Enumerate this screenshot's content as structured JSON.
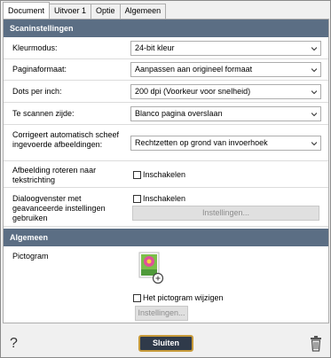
{
  "tabs": [
    "Document",
    "Uitvoer 1",
    "Optie",
    "Algemeen"
  ],
  "sections": {
    "scan": "Scaninstellingen",
    "general": "Algemeen"
  },
  "fields": {
    "color_mode": {
      "label": "Kleurmodus:",
      "value": "24-bit kleur"
    },
    "page_format": {
      "label": "Paginaformaat:",
      "value": "Aanpassen aan origineel formaat"
    },
    "dpi": {
      "label": "Dots per inch:",
      "value": "200 dpi (Voorkeur voor snelheid)"
    },
    "side": {
      "label": "Te scannen zijde:",
      "value": "Blanco pagina overslaan"
    },
    "deskew": {
      "label": "Corrigeert automatisch scheef ingevoerde afbeeldingen:",
      "value": "Rechtzetten op grond van invoerhoek"
    },
    "rotate": {
      "label": "Afbeelding roteren naar tekstrichting",
      "checkbox": "Inschakelen"
    },
    "advanced": {
      "label": "Dialoogvenster met geavanceerde instellingen gebruiken",
      "checkbox": "Inschakelen",
      "button": "Instellingen..."
    }
  },
  "general": {
    "icon_label": "Pictogram",
    "change_checkbox": "Het pictogram wijzigen",
    "settings_button": "Instellingen..."
  },
  "footer": {
    "help": "?",
    "close": "Sluiten"
  },
  "icons": {
    "dropdown": "chevron-down-icon",
    "delete": "trash-icon",
    "thumbnail": "image-thumbnail-icon"
  },
  "colors": {
    "section_header": "#5b6e84",
    "close_border": "#c79a3a",
    "close_bg": "#2f3a4a"
  }
}
